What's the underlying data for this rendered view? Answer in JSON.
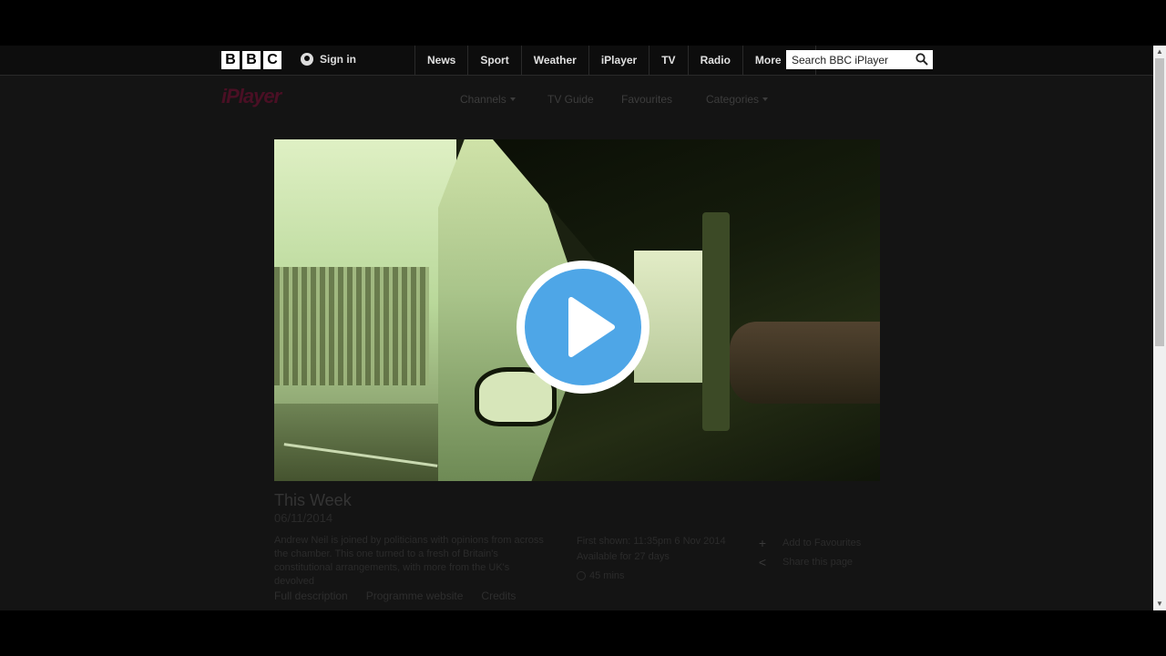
{
  "bbc_nav": {
    "logo_letters": [
      "B",
      "B",
      "C"
    ],
    "signin_label": "Sign in",
    "links": [
      "News",
      "Sport",
      "Weather",
      "iPlayer",
      "TV",
      "Radio"
    ],
    "more_label": "More",
    "search_placeholder": "Search BBC iPlayer"
  },
  "iplayer_nav": {
    "logo": "iPlayer",
    "channels_label": "Channels",
    "tv_guide_label": "TV Guide",
    "favourites_label": "Favourites",
    "categories_label": "Categories"
  },
  "programme": {
    "title": "This Week",
    "date": "06/11/2014",
    "description": "Andrew Neil is joined by politicians with opinions from across the chamber. This one turned to a fresh of Britain's constitutional arrangements, with more from the UK's devolved",
    "first_shown": "First shown: 11:35pm 6 Nov 2014",
    "availability": "Available for 27 days",
    "duration": "45 mins"
  },
  "actions": {
    "add_favourites": "Add to Favourites",
    "share": "Share this page"
  },
  "tabs": [
    "Full description",
    "Programme website",
    "Credits"
  ],
  "colors": {
    "page_bg": "#141414",
    "play_accent": "#4ea6e7"
  },
  "icons": [
    "user-icon",
    "search-icon",
    "play-icon",
    "plus-icon",
    "share-icon",
    "clock-icon"
  ]
}
